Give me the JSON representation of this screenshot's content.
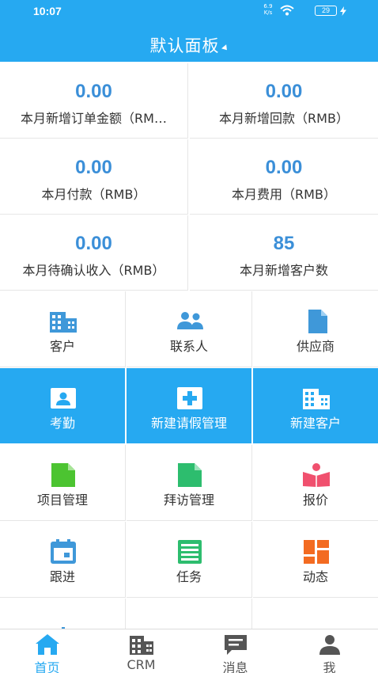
{
  "status_bar": {
    "time": "10:07",
    "net_speed_top": "6.9",
    "net_speed_bottom": "K/s",
    "battery": "29"
  },
  "header": {
    "title": "默认面板"
  },
  "stats": [
    {
      "value": "0.00",
      "label": "本月新增订单金额（RM…"
    },
    {
      "value": "0.00",
      "label": "本月新增回款（RMB）"
    },
    {
      "value": "0.00",
      "label": "本月付款（RMB）"
    },
    {
      "value": "0.00",
      "label": "本月费用（RMB）"
    },
    {
      "value": "0.00",
      "label": "本月待确认收入（RMB）"
    },
    {
      "value": "85",
      "label": "本月新增客户数"
    }
  ],
  "tiles": [
    {
      "label": "客户",
      "icon": "building-icon",
      "active": false
    },
    {
      "label": "联系人",
      "icon": "contacts-icon",
      "active": false
    },
    {
      "label": "供应商",
      "icon": "document-icon",
      "active": false
    },
    {
      "label": "考勤",
      "icon": "id-card-icon",
      "active": true
    },
    {
      "label": "新建请假管理",
      "icon": "plus-box-icon",
      "active": true
    },
    {
      "label": "新建客户",
      "icon": "building-icon",
      "active": true
    },
    {
      "label": "项目管理",
      "icon": "file-green-icon",
      "active": false
    },
    {
      "label": "拜访管理",
      "icon": "file-teal-icon",
      "active": false
    },
    {
      "label": "报价",
      "icon": "reader-icon",
      "active": false
    },
    {
      "label": "跟进",
      "icon": "calendar-icon",
      "active": false
    },
    {
      "label": "任务",
      "icon": "list-icon",
      "active": false
    },
    {
      "label": "动态",
      "icon": "dashboard-icon",
      "active": false
    },
    {
      "label": "",
      "icon": "plus-icon",
      "active": false
    }
  ],
  "tabs": [
    {
      "label": "首页",
      "icon": "home-icon",
      "active": true
    },
    {
      "label": "CRM",
      "icon": "building-icon",
      "active": false
    },
    {
      "label": "消息",
      "icon": "message-icon",
      "active": false
    },
    {
      "label": "我",
      "icon": "user-icon",
      "active": false
    }
  ],
  "colors": {
    "primary": "#26a9f1",
    "stat_value": "#3b8fd8",
    "green": "#4cc431",
    "teal": "#2dbd6e",
    "red": "#f0506e",
    "orange": "#f36b21",
    "icon_blue": "#3f98d9"
  }
}
